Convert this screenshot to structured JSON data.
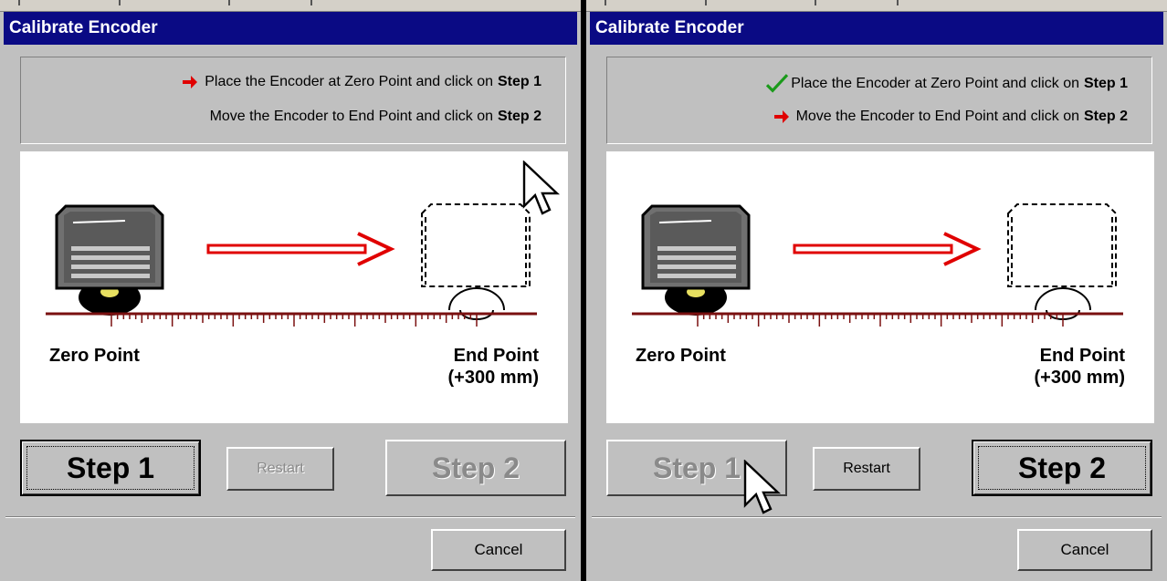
{
  "panels": [
    {
      "title": "Calibrate Encoder",
      "instructions": [
        {
          "text": "Place the Encoder at Zero Point and click on",
          "bold": "Step 1",
          "marker": "red-arrow"
        },
        {
          "text": "Move the Encoder to End Point and click on",
          "bold": "Step 2",
          "marker": "none"
        }
      ],
      "zero_label": "Zero Point",
      "end_label_1": "End Point",
      "end_label_2": "(+300 mm)",
      "step1_label": "Step 1",
      "restart_label": "Restart",
      "step2_label": "Step 2",
      "cancel_label": "Cancel",
      "state": {
        "step1": "focused",
        "restart": "disabled",
        "step2": "disabled"
      }
    },
    {
      "title": "Calibrate Encoder",
      "instructions": [
        {
          "text": "Place the Encoder at Zero Point and click on",
          "bold": "Step 1",
          "marker": "green-check"
        },
        {
          "text": "Move the Encoder to End Point and click on",
          "bold": "Step 2",
          "marker": "red-arrow"
        }
      ],
      "zero_label": "Zero Point",
      "end_label_1": "End Point",
      "end_label_2": "(+300 mm)",
      "step1_label": "Step 1",
      "restart_label": "Restart",
      "step2_label": "Step 2",
      "cancel_label": "Cancel",
      "state": {
        "step1": "disabled",
        "restart": "enabled",
        "step2": "focused"
      }
    }
  ],
  "colors": {
    "titlebar": "#0a0a84",
    "arrow": "#e00000",
    "check": "#1a9a1a",
    "ruler": "#7a1010"
  },
  "icons": {
    "arrow": "red-arrow-icon",
    "check": "green-check-icon",
    "cursor": "mouse-pointer-icon"
  }
}
